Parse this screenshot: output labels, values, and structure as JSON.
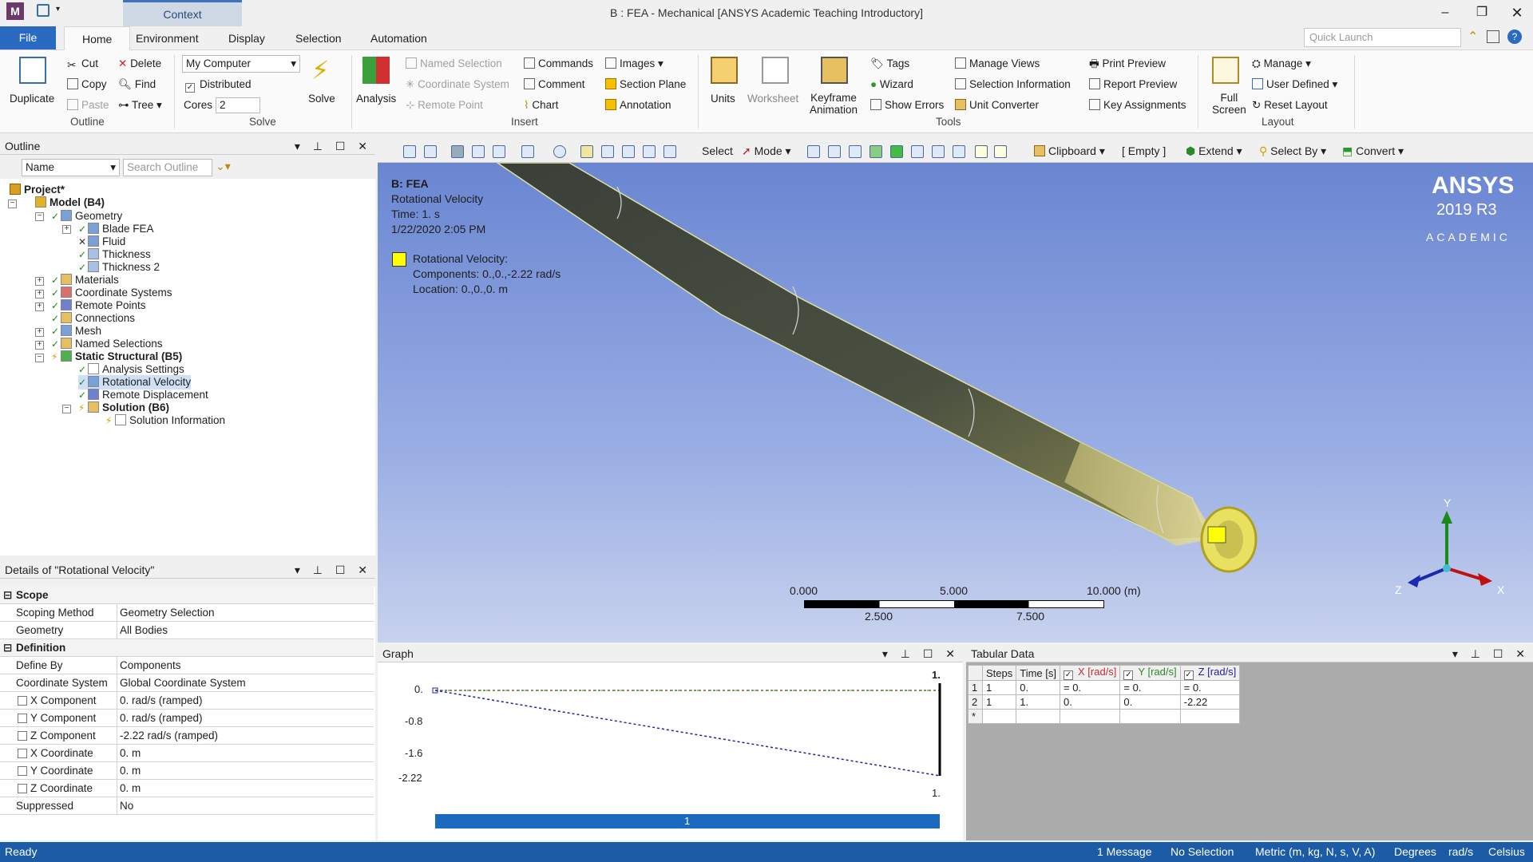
{
  "window": {
    "title": "B : FEA - Mechanical [ANSYS Academic Teaching Introductory]",
    "context_tab": "Context",
    "app_letter": "M"
  },
  "menu": {
    "file": "File",
    "tabs": [
      "Home",
      "Environment",
      "Display",
      "Selection",
      "Automation"
    ],
    "quick_launch": "Quick Launch"
  },
  "ribbon": {
    "duplicate": "Duplicate",
    "cut": "Cut",
    "copy": "Copy",
    "paste": "Paste",
    "delete": "Delete",
    "find": "Find",
    "tree": "Tree",
    "outline_group": "Outline",
    "solver_target": "My Computer",
    "distributed": "Distributed",
    "cores_label": "Cores",
    "cores_value": "2",
    "solve": "Solve",
    "solve_group": "Solve",
    "analysis": "Analysis",
    "named_selection": "Named Selection",
    "coordinate_system": "Coordinate System",
    "remote_point": "Remote Point",
    "commands": "Commands",
    "comment": "Comment",
    "chart": "Chart",
    "images": "Images",
    "section_plane": "Section Plane",
    "annotation": "Annotation",
    "insert_group": "Insert",
    "units": "Units",
    "worksheet": "Worksheet",
    "keyframe1": "Keyframe",
    "keyframe2": "Animation",
    "tags": "Tags",
    "wizard": "Wizard",
    "show_errors": "Show Errors",
    "manage_views": "Manage Views",
    "selection_information": "Selection Information",
    "unit_converter": "Unit Converter",
    "print_preview": "Print Preview",
    "report_preview": "Report Preview",
    "key_assignments": "Key Assignments",
    "tools_group": "Tools",
    "full1": "Full",
    "full2": "Screen",
    "manage": "Manage",
    "user_defined": "User Defined",
    "reset_layout": "Reset Layout",
    "layout_group": "Layout"
  },
  "outline": {
    "title": "Outline",
    "name_filter": "Name",
    "search_placeholder": "Search Outline",
    "nodes": [
      "Project*",
      "Model (B4)",
      "Geometry",
      "Blade FEA",
      "Fluid",
      "Thickness",
      "Thickness 2",
      "Materials",
      "Coordinate Systems",
      "Remote Points",
      "Connections",
      "Mesh",
      "Named Selections",
      "Static Structural (B5)",
      "Analysis Settings",
      "Rotational Velocity",
      "Remote Displacement",
      "Solution (B6)",
      "Solution Information"
    ]
  },
  "details": {
    "title": "Details of \"Rotational Velocity\"",
    "rows": [
      {
        "k": "Scope",
        "v": ""
      },
      {
        "k": "Scoping Method",
        "v": "Geometry Selection"
      },
      {
        "k": "Geometry",
        "v": "All Bodies"
      },
      {
        "k": "Definition",
        "v": ""
      },
      {
        "k": "Define By",
        "v": "Components"
      },
      {
        "k": "Coordinate System",
        "v": "Global Coordinate System"
      },
      {
        "k": "X Component",
        "v": "0. rad/s  (ramped)"
      },
      {
        "k": "Y Component",
        "v": "0. rad/s  (ramped)"
      },
      {
        "k": "Z Component",
        "v": "-2.22 rad/s  (ramped)"
      },
      {
        "k": "X Coordinate",
        "v": "0. m"
      },
      {
        "k": "Y Coordinate",
        "v": "0. m"
      },
      {
        "k": "Z Coordinate",
        "v": "0. m"
      },
      {
        "k": "Suppressed",
        "v": "No"
      }
    ]
  },
  "viewer_toolbar": {
    "select": "Select",
    "mode": "Mode",
    "clipboard": "Clipboard",
    "empty": "[ Empty ]",
    "extend": "Extend",
    "select_by": "Select By",
    "convert": "Convert"
  },
  "viewer": {
    "title": "B: FEA",
    "subtitle": "Rotational Velocity",
    "time": "Time: 1. s",
    "date": "1/22/2020 2:05 PM",
    "legend_title": "Rotational Velocity:",
    "legend_components": "Components: 0.,0.,-2.22 rad/s",
    "legend_location": "Location: 0.,0.,0. m",
    "logo1": "ANSYS",
    "logo2": "2019 R3",
    "logo3": "ACADEMIC",
    "scale": {
      "s0": "0.000",
      "s1": "5.000",
      "s2": "10.000 (m)",
      "s3": "2.500",
      "s4": "7.500"
    },
    "axes": {
      "x": "X",
      "y": "Y",
      "z": "Z"
    }
  },
  "graph": {
    "title": "Graph",
    "ylabels": [
      "0.",
      "-0.8",
      "-1.6",
      "-2.22"
    ],
    "xlabel_top": "1.",
    "xlabel_bottom": "1.",
    "step": "1",
    "colors": {
      "x": "#c03030",
      "y": "#2a8a2a",
      "z": "#2020a0"
    }
  },
  "tabular": {
    "title": "Tabular Data",
    "headers": [
      "Steps",
      "Time [s]",
      "X [rad/s]",
      "Y [rad/s]",
      "Z [rad/s]"
    ],
    "rows": [
      [
        "1",
        "1",
        "0.",
        "= 0.",
        "= 0.",
        "= 0."
      ],
      [
        "2",
        "1",
        "1.",
        "0.",
        "0.",
        "-2.22"
      ],
      [
        "*",
        "",
        "",
        "",
        "",
        ""
      ]
    ]
  },
  "status": {
    "ready": "Ready",
    "messages": "1 Message",
    "selection": "No Selection",
    "units": "Metric (m, kg, N, s, V, A)",
    "angle": "Degrees",
    "rate": "rad/s",
    "temp": "Celsius"
  }
}
